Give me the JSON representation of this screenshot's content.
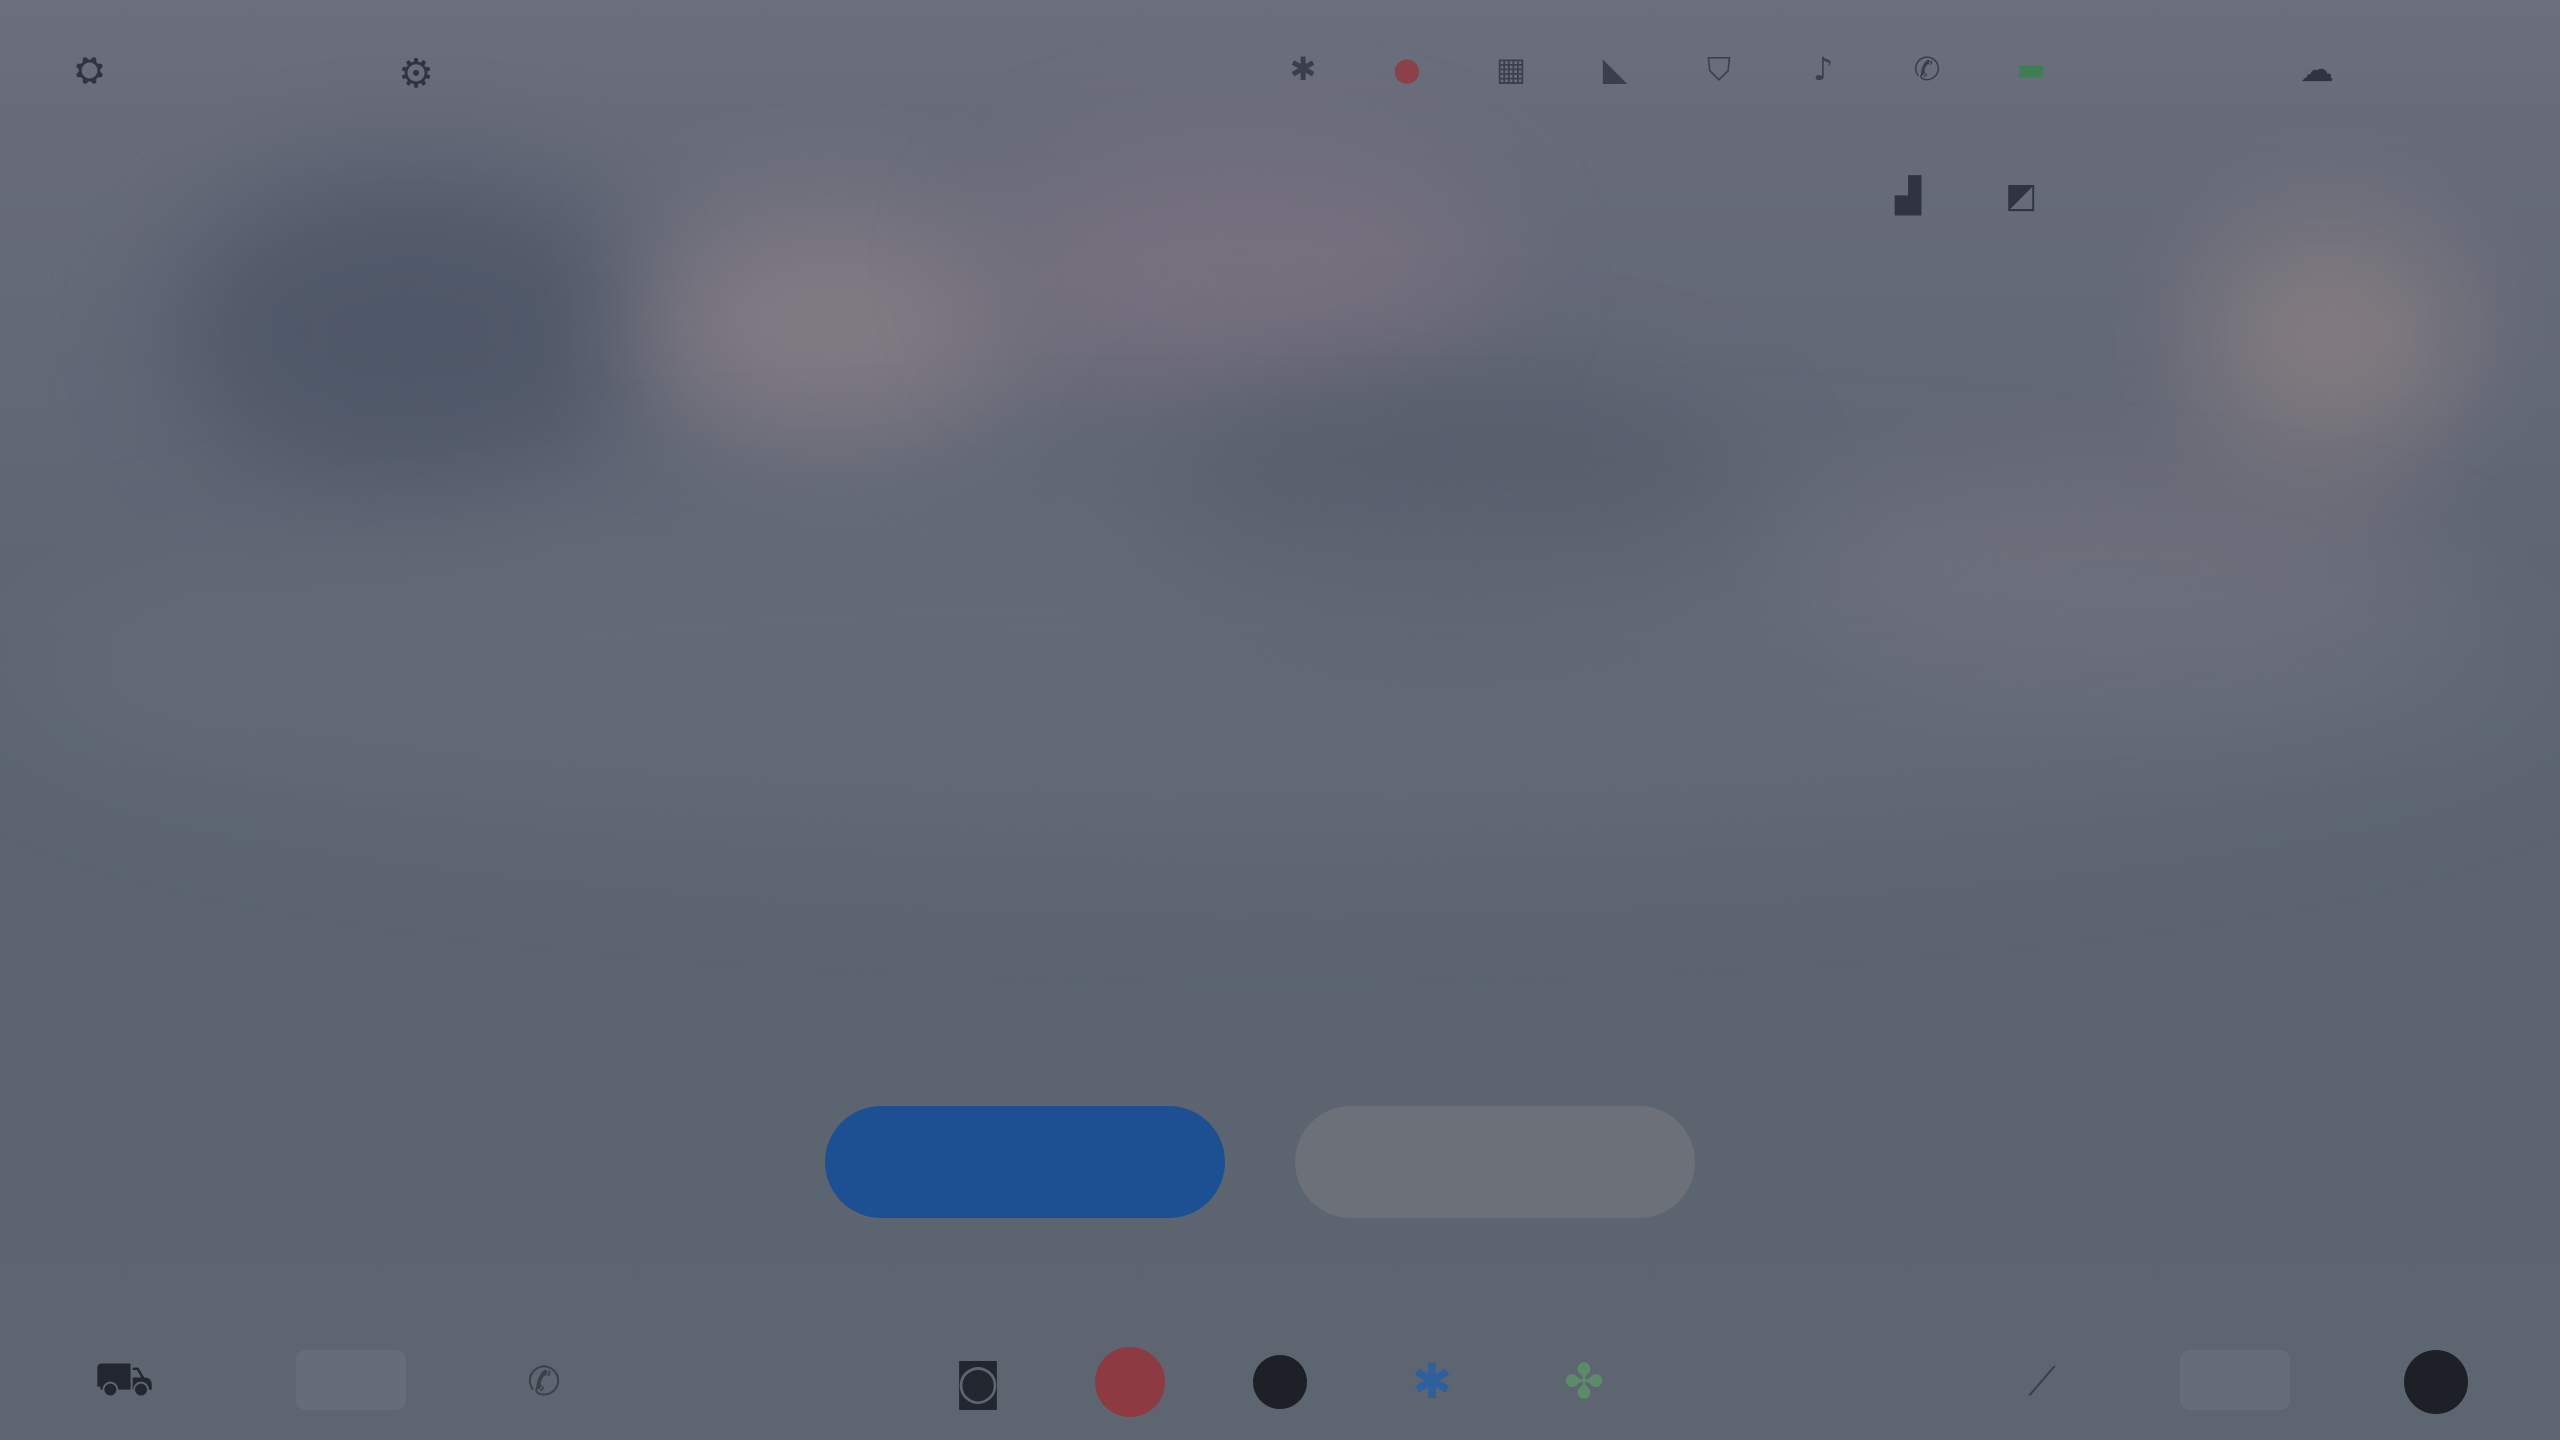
{
  "statusbar": {
    "left_label": "",
    "time": "",
    "weather": "",
    "icons": [
      "bluetooth-icon",
      "record-icon",
      "grid-icon",
      "signal-icon",
      "shield-icon",
      "music-icon",
      "phone-icon",
      "battery-icon"
    ]
  },
  "quick_actions": {
    "left_label": "",
    "right_label": ""
  },
  "hero": {
    "title": "",
    "subtitle": "",
    "description": "",
    "link": ""
  },
  "buttons": {
    "primary": "",
    "secondary": ""
  },
  "dock": {
    "left_temp": "",
    "right_temp": ""
  },
  "colors": {
    "primary_button": "#1d4f93",
    "record": "#8e3a43",
    "link": "#4f8fcf"
  }
}
